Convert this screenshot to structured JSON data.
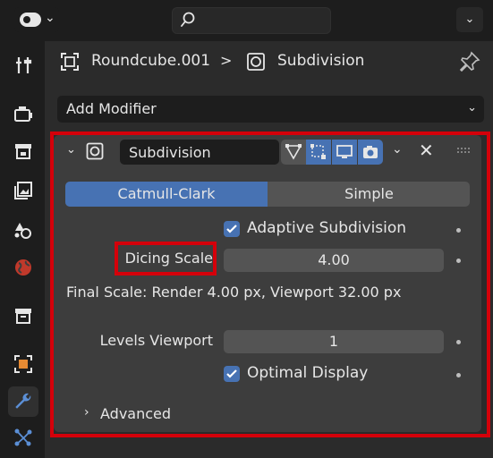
{
  "header": {
    "editor_type_icon": "properties-editor-icon",
    "search": {
      "value": "",
      "placeholder": ""
    }
  },
  "sidebar": {
    "tabs": [
      {
        "name": "tool",
        "icon": "tool-settings-icon"
      },
      {
        "name": "render",
        "icon": "render-icon"
      },
      {
        "name": "output",
        "icon": "output-icon"
      },
      {
        "name": "view-layer",
        "icon": "view-layer-icon"
      },
      {
        "name": "scene",
        "icon": "scene-icon"
      },
      {
        "name": "world",
        "icon": "world-icon"
      },
      {
        "name": "collection",
        "icon": "collection-icon"
      },
      {
        "name": "object",
        "icon": "object-icon"
      },
      {
        "name": "modifiers",
        "icon": "wrench-icon",
        "active": true
      },
      {
        "name": "particles",
        "icon": "particles-icon"
      }
    ]
  },
  "breadcrumb": {
    "object": "Roundcube.001",
    "separator": ">",
    "modifier": "Subdivision"
  },
  "add_modifier": {
    "label": "Add Modifier"
  },
  "modifier": {
    "name": "Subdivision",
    "tabs": [
      "Catmull-Clark",
      "Simple"
    ],
    "selected_tab": "Catmull-Clark",
    "adaptive_subdivision": {
      "label": "Adaptive Subdivision",
      "checked": true
    },
    "dicing_scale": {
      "label": "Dicing Scale",
      "value": "4.00"
    },
    "final_scale": "Final Scale: Render 4.00 px, Viewport 32.00 px",
    "levels_viewport": {
      "label": "Levels Viewport",
      "value": "1"
    },
    "optimal_display": {
      "label": "Optimal Display",
      "checked": true
    },
    "advanced": {
      "label": "Advanced",
      "expanded": false
    }
  },
  "colors": {
    "accent": "#4772b3",
    "highlight": "#d4000a",
    "panel": "#3d3d3d",
    "background": "#2b2b2b"
  }
}
